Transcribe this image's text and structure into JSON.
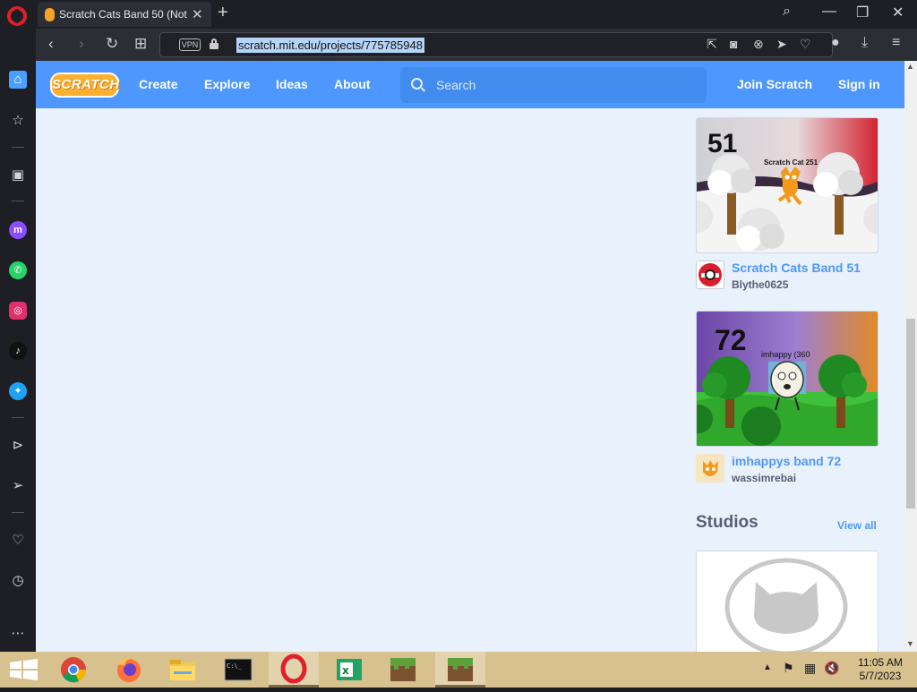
{
  "browser": {
    "tab_title": "Scratch Cats Band 50 (Not",
    "url": "scratch.mit.edu/projects/775785948",
    "vpn_label": "VPN"
  },
  "scratch_nav": {
    "logo": "SCRATCH",
    "links": [
      "Create",
      "Explore",
      "Ideas",
      "About"
    ],
    "search_placeholder": "Search",
    "join": "Join Scratch",
    "signin": "Sign in"
  },
  "projects": [
    {
      "title": "Scratch Cats Band 51",
      "author": "Blythe0625",
      "thumb_number": "51",
      "thumb_caption": "Scratch Cat 251"
    },
    {
      "title": "imhappys band 72",
      "author": "wassimrebai",
      "thumb_number": "72",
      "thumb_caption": "imhappy (360"
    }
  ],
  "studios": {
    "heading": "Studios",
    "view_all": "View all"
  },
  "clock": {
    "time": "11:05 AM",
    "date": "5/7/2023"
  },
  "icons": {
    "sidebar": [
      "home-icon",
      "star-icon",
      "shopping-bag-icon",
      "messenger-icon",
      "whatsapp-icon",
      "instagram-icon",
      "tiktok-icon",
      "twitter-icon",
      "player-icon",
      "send-icon",
      "heart-icon",
      "history-icon",
      "more-icon"
    ],
    "taskbar": [
      "windows-start-icon",
      "chrome-icon",
      "firefox-icon",
      "file-explorer-icon",
      "terminal-icon",
      "opera-icon",
      "excel-icon",
      "minecraft-icon",
      "minecraft-icon"
    ]
  },
  "colors": {
    "scratch_blue": "#4d97ff",
    "page_bg": "#e9f1fc",
    "opera_red": "#e0202b",
    "taskbar": "#d7c18f"
  }
}
